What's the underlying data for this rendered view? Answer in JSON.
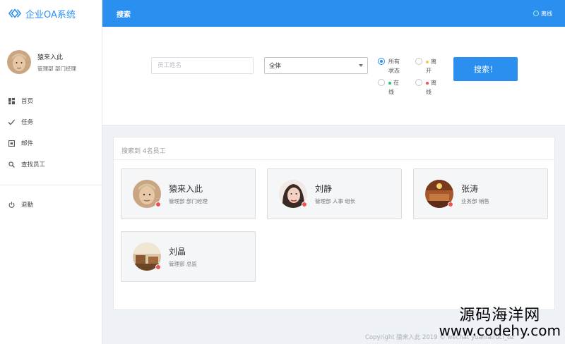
{
  "app": {
    "title": "企业OA系统"
  },
  "user": {
    "name": "猿来入此",
    "role": "管理部 部门经理"
  },
  "nav": {
    "items": [
      {
        "label": "首页",
        "icon": "dashboard-icon"
      },
      {
        "label": "任务",
        "icon": "check-icon"
      },
      {
        "label": "邮件",
        "icon": "mail-icon"
      },
      {
        "label": "查找员工",
        "icon": "search-icon"
      }
    ],
    "logout_label": "退勤"
  },
  "header": {
    "title": "搜索",
    "status": "离线"
  },
  "search": {
    "name_placeholder": "员工姓名",
    "dept_selected": "全体",
    "radios": [
      {
        "label": "所有状态",
        "checked": true,
        "dot_color": ""
      },
      {
        "label": "离开",
        "checked": false,
        "dot_color": "#f2c94c"
      },
      {
        "label": "在线",
        "checked": false,
        "dot_color": "#27c46b"
      },
      {
        "label": "离线",
        "checked": false,
        "dot_color": "#f05050"
      }
    ],
    "button_label": "搜索！"
  },
  "results": {
    "count_text": "搜索到 4名员工",
    "employees": [
      {
        "name": "猿来入此",
        "dept": "管理部 部门经理",
        "status_color": "#f05050"
      },
      {
        "name": "刘静",
        "dept": "管理部 人事 组长",
        "status_color": "#f05050"
      },
      {
        "name": "张涛",
        "dept": "业务部 销售",
        "status_color": "#f05050"
      },
      {
        "name": "刘晶",
        "dept": "管理部 总监",
        "status_color": "#f05050"
      }
    ]
  },
  "footer": {
    "text": "Copyright 猿来入此 2019 ©   wechat yuanlairuci_oz"
  },
  "watermark": {
    "line1": "源码海洋网",
    "line2": "www.codehy.com"
  }
}
